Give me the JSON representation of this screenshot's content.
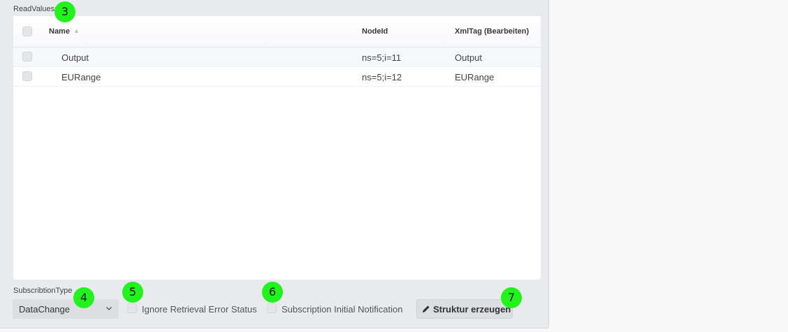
{
  "section_label": "ReadValues:",
  "table": {
    "columns": {
      "name": "Name",
      "nodeid": "NodeId",
      "xmltag": "XmlTag (Bearbeiten)"
    },
    "rows": [
      {
        "name": "Output",
        "nodeid": "ns=5;i=11",
        "xmltag": "Output"
      },
      {
        "name": "EURange",
        "nodeid": "ns=5;i=12",
        "xmltag": "EURange"
      }
    ]
  },
  "subscription": {
    "label": "SubscribtionType",
    "selected": "DataChange"
  },
  "checkboxes": {
    "ignore_retrieval": "Ignore Retrieval Error Status",
    "initial_notification": "Subscription Initial Notification"
  },
  "button": {
    "label": "Struktur erzeugen"
  },
  "markers": [
    "3",
    "4",
    "5",
    "6",
    "7"
  ],
  "colors": {
    "marker": "#22f31c",
    "panel": "#e8eaed",
    "control": "#dcdee2"
  }
}
